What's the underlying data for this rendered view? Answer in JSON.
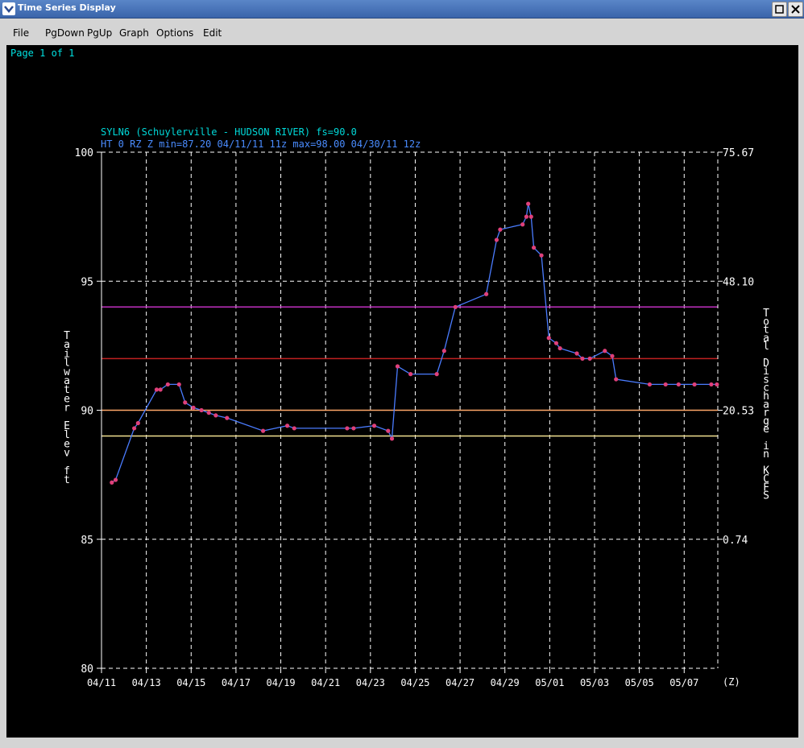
{
  "window": {
    "title": "Time Series Display"
  },
  "menu": [
    "File",
    "PgDown",
    "PgUp",
    "Graph",
    "Options",
    "Edit"
  ],
  "page_info": "Page 1 of 1",
  "colors": {
    "background": "#000000",
    "series": "#4a7cff",
    "markers": "#e0407a",
    "grid": "#ffffff",
    "label": "#00d8d8",
    "info_line": "#4a8cff",
    "threshold_magenta": "#c030c0",
    "threshold_red": "#c02020",
    "threshold_orange": "#ffa868",
    "threshold_yellow": "#f0e090"
  },
  "chart_data": {
    "type": "line",
    "title": "SYLN6 (Schuylerville - HUDSON RIVER) fs=90.0",
    "subtitle": "HT 0 RZ Z min=87.20 04/11/11 11z max=98.00 04/30/11 12z",
    "ylabel": "Tailwater Elev ft",
    "y2label": "Total Discharge in KCFS",
    "xlabel": "(Z)",
    "ylim": [
      80,
      100
    ],
    "y_ticks": [
      "100",
      "95",
      "90",
      "85",
      "80"
    ],
    "y2_ticks": [
      "75.67",
      "48.10",
      "20.53",
      "0.74"
    ],
    "x_ticks": [
      "04/11",
      "04/13",
      "04/15",
      "04/17",
      "04/19",
      "04/21",
      "04/23",
      "04/25",
      "04/27",
      "04/29",
      "05/01",
      "05/03",
      "05/05",
      "05/07"
    ],
    "x_range_days": [
      0,
      27.5
    ],
    "grid": true,
    "thresholds": [
      {
        "value": 94.0,
        "color": "#c030c0"
      },
      {
        "value": 92.0,
        "color": "#c02020"
      },
      {
        "value": 90.0,
        "color": "#ffa868"
      },
      {
        "value": 89.0,
        "color": "#f0e090"
      }
    ],
    "series": [
      {
        "x": [
          0.46,
          0.63,
          1.46,
          1.63,
          2.46,
          2.63,
          2.96,
          3.46,
          3.73,
          4.1,
          4.46,
          4.79,
          5.1,
          5.6,
          7.21,
          8.29,
          8.6,
          10.96,
          11.25,
          12.17,
          12.79,
          12.96,
          13.21,
          13.79,
          14.96,
          15.29,
          15.79,
          17.17,
          17.63,
          17.79,
          18.79,
          18.96,
          19.04,
          19.17,
          19.29,
          19.63,
          19.96,
          20.29,
          20.46,
          21.21,
          21.46,
          21.79,
          22.46,
          22.79,
          22.96,
          24.46,
          25.17,
          25.75,
          26.46,
          27.21,
          27.46
        ],
        "y": [
          87.2,
          87.3,
          89.3,
          89.5,
          90.8,
          90.8,
          91.0,
          91.0,
          90.3,
          90.1,
          90.0,
          89.9,
          89.8,
          89.7,
          89.2,
          89.4,
          89.3,
          89.3,
          89.3,
          89.4,
          89.2,
          88.9,
          91.7,
          91.4,
          91.4,
          92.3,
          94.0,
          94.5,
          96.6,
          97.0,
          97.2,
          97.5,
          98.0,
          97.5,
          96.3,
          96.0,
          92.8,
          92.6,
          92.4,
          92.2,
          92.0,
          92.0,
          92.3,
          92.1,
          91.2,
          91.0,
          91.0,
          91.0,
          91.0,
          91.0,
          91.0
        ]
      }
    ]
  }
}
